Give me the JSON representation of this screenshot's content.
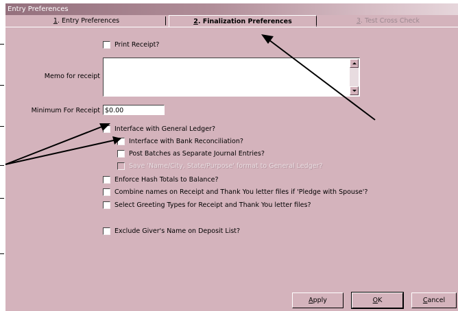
{
  "window": {
    "title": "Entry Preferences"
  },
  "tabs": [
    {
      "accel": "1",
      "label": ". Entry Preferences"
    },
    {
      "accel": "2",
      "label": ". Finalization Preferences"
    },
    {
      "accel": "3",
      "label": ". Test Cross Check"
    }
  ],
  "form": {
    "print_receipt": {
      "label": "Print Receipt?",
      "checked": false
    },
    "memo_label": "Memo for receipt",
    "memo_value": "",
    "minimum_label": "Minimum For Receipt",
    "minimum_value": "$0.00",
    "interface_gl": {
      "label": "Interface with General Ledger?",
      "checked": false
    },
    "interface_bank": {
      "label": "Interface with Bank Reconciliation?",
      "checked": false
    },
    "post_batches": {
      "label": "Post Batches as Separate Journal Entries?",
      "checked": false
    },
    "save_format": {
      "label": "Save 'Name/City, State/Purpose' format to General Ledger?",
      "checked": false,
      "disabled": true
    },
    "hash_totals": {
      "label": "Enforce Hash Totals to Balance?",
      "checked": false
    },
    "combine_names": {
      "label": "Combine names on Receipt and Thank You letter files if 'Pledge with Spouse'?",
      "checked": false
    },
    "greeting_types": {
      "label": "Select Greeting Types for Receipt and Thank You letter files?",
      "checked": false
    },
    "exclude_giver": {
      "label": "Exclude Giver's Name on Deposit List?",
      "checked": false
    }
  },
  "buttons": {
    "apply": {
      "accel": "A",
      "rest": "pply"
    },
    "ok": {
      "accel": "O",
      "rest": "K"
    },
    "cancel": {
      "accel": "C",
      "rest": "ancel"
    }
  },
  "colors": {
    "dialog_bg": "#d4b3bc",
    "titlebar": "#94707d",
    "arrow": "#000000"
  }
}
